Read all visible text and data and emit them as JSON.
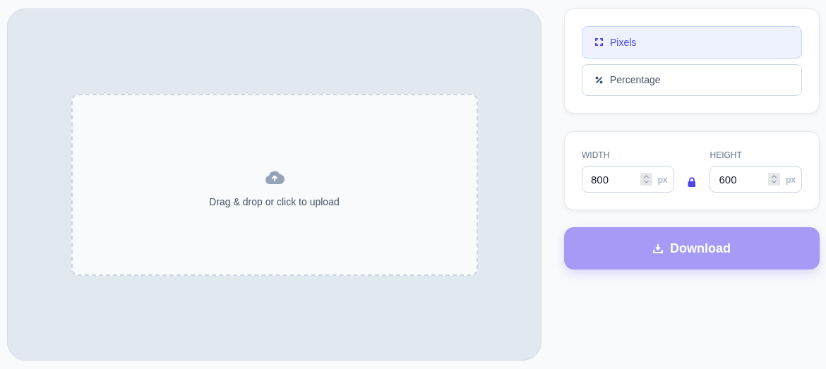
{
  "upload": {
    "text": "Drag & drop or click to upload"
  },
  "units": [
    {
      "kind": "pixels",
      "label": "Pixels",
      "selected": true
    },
    {
      "kind": "percentage",
      "label": "Percentage",
      "selected": false
    }
  ],
  "dimensions": {
    "width": {
      "label": "WIDTH",
      "value": "800",
      "unit": "px"
    },
    "height": {
      "label": "HEIGHT",
      "value": "600",
      "unit": "px"
    },
    "locked": true
  },
  "download": {
    "label": "Download",
    "disabled": true
  }
}
